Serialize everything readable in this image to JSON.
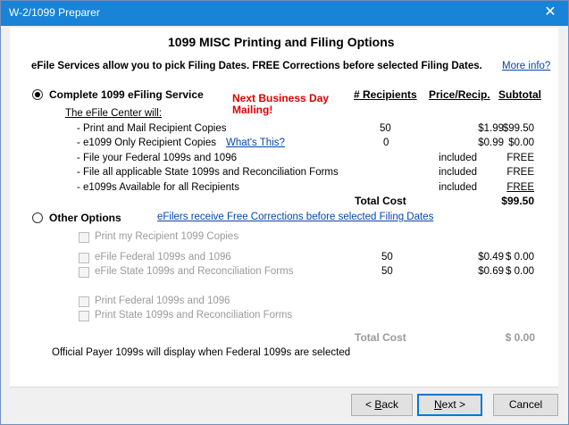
{
  "window": {
    "title": "W-2/1099 Preparer",
    "close_glyph": "✕"
  },
  "header": {
    "title": "1099 MISC Printing and Filing Options",
    "subtitle": "eFile Services allow you to pick Filing Dates. FREE Corrections before selected Filing Dates.",
    "more_info": "More info?"
  },
  "columns": {
    "recipients": "# Recipients",
    "price": "Price/Recip.",
    "subtotal": "Subtotal"
  },
  "complete": {
    "label": "Complete 1099 eFiling Service",
    "promo_line1": "Next Business Day",
    "promo_line2": "Mailing!",
    "efile_center": "The eFile Center will:",
    "whats_this": "What's This?",
    "rows": [
      {
        "label": "-  Print and Mail Recipient Copies",
        "recipients": "50",
        "price": "$1.99",
        "subtotal": "$99.50"
      },
      {
        "label": "-  e1099 Only Recipient Copies",
        "recipients": "0",
        "price": "$0.99",
        "subtotal": "$0.00"
      },
      {
        "label": "-  File your Federal 1099s and 1096",
        "recipients": "",
        "price": "included",
        "subtotal": "FREE"
      },
      {
        "label": "-  File all applicable State 1099s and Reconciliation Forms",
        "recipients": "",
        "price": "included",
        "subtotal": "FREE"
      },
      {
        "label": "- e1099s Available for all Recipients",
        "recipients": "",
        "price": "included",
        "subtotal": "FREE"
      }
    ],
    "total_label": "Total Cost",
    "total_value": "$99.50",
    "selected": true
  },
  "other": {
    "label": "Other Options",
    "efilers_link": "eFilers receive Free Corrections before selected Filing Dates",
    "print_recipient": "Print my Recipient 1099 Copies",
    "efile_federal": {
      "label": "eFile Federal 1099s and 1096",
      "recipients": "50",
      "price": "$0.49",
      "subtotal": "$ 0.00"
    },
    "efile_state": {
      "label": "eFile State 1099s and Reconciliation Forms",
      "recipients": "50",
      "price": "$0.69",
      "subtotal": "$ 0.00"
    },
    "print_federal": "Print Federal 1099s and 1096",
    "print_state": "Print State 1099s and Reconciliation Forms",
    "total_label": "Total Cost",
    "total_value": "$ 0.00",
    "selected": false
  },
  "footnote": "Official Payer 1099s will display when Federal 1099s are selected",
  "buttons": {
    "back_arrow": "< ",
    "back_u": "B",
    "back_rest": "ack",
    "next_u": "N",
    "next_rest": "ext >",
    "cancel": "Cancel"
  }
}
